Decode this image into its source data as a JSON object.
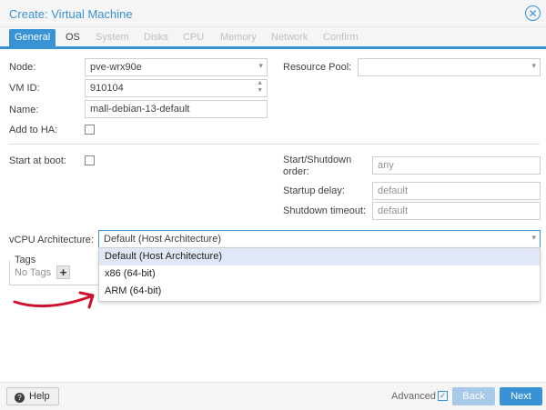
{
  "window": {
    "title": "Create: Virtual Machine",
    "close_icon": "close-circle-icon"
  },
  "tabs": [
    {
      "label": "General",
      "state": "active"
    },
    {
      "label": "OS",
      "state": "enabled"
    },
    {
      "label": "System",
      "state": "disabled"
    },
    {
      "label": "Disks",
      "state": "disabled"
    },
    {
      "label": "CPU",
      "state": "disabled"
    },
    {
      "label": "Memory",
      "state": "disabled"
    },
    {
      "label": "Network",
      "state": "disabled"
    },
    {
      "label": "Confirm",
      "state": "disabled"
    }
  ],
  "form": {
    "node": {
      "label": "Node:",
      "value": "pve-wrx90e"
    },
    "vmid": {
      "label": "VM ID:",
      "value": "910104"
    },
    "name": {
      "label": "Name:",
      "value": "mall-debian-13-default"
    },
    "ha": {
      "label": "Add to HA:"
    },
    "resource_pool": {
      "label": "Resource Pool:",
      "value": ""
    },
    "start_at_boot": {
      "label": "Start at boot:"
    },
    "start_shutdown_order": {
      "label_line1": "Start/Shutdown",
      "label_line2": "order:",
      "placeholder": "any"
    },
    "startup_delay": {
      "label": "Startup delay:",
      "placeholder": "default"
    },
    "shutdown_timeout": {
      "label": "Shutdown timeout:",
      "placeholder": "default"
    },
    "vcpu_arch": {
      "label": "vCPU Architecture:",
      "value": "Default (Host Architecture)",
      "options": [
        "Default (Host Architecture)",
        "x86 (64-bit)",
        "ARM (64-bit)"
      ],
      "selected_index": 0
    },
    "tags": {
      "legend": "Tags",
      "empty_text": "No Tags",
      "add_label": "+"
    }
  },
  "footer": {
    "help_label": "Help",
    "advanced_label": "Advanced",
    "advanced_checked": true,
    "back_label": "Back",
    "next_label": "Next"
  },
  "colors": {
    "accent": "#3892d4",
    "annotation": "#d0102a",
    "selected_option": "#dfe8f6"
  }
}
